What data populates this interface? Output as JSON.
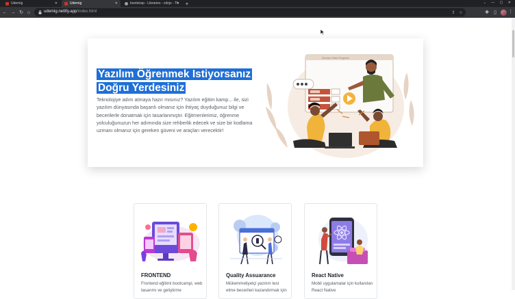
{
  "browser": {
    "tabs": [
      {
        "title": "Udemig"
      },
      {
        "title": "Udemig"
      },
      {
        "title": "bootstrap - Libraries - cdnjs - Th"
      }
    ],
    "new_tab": "+",
    "url_host": "udemig.netlify.app",
    "url_path": "/index.html"
  },
  "hero": {
    "title_line1": "Yazılım Öğrenmek Istiyorsanız",
    "title_line2": "Doğru Yerdesiniz",
    "description": "Teknolojiye adım atmaya hazır mısınız? Yazılım eğitim kamp... ile, sizi yazılım dünyasında başarılı olmanız için ihtiyaç duyduğunuz bilgi ve becerilerle donatmak için tasarlanmıştır. Eğitmenlerimiz, öğrenme yolculuğunuzun her adımında size rehberlik edecek ve size bir kodlama uzmanı olmanız için gereken güveni ve araçları verecektir!",
    "illustration": "online-learning-illustration",
    "illustration_panel_text": "Discover Online Programs"
  },
  "cards": [
    {
      "title": "FRONTEND",
      "text": "Frontend eğitimi bootcampi, web tasarımı ve geliştirme",
      "illustration": "frontend-illustration"
    },
    {
      "title": "Quality Assuarance",
      "text": "Mükemmeliyetçi yazılım test etme becerileri kazandırmak için",
      "illustration": "qa-illustration"
    },
    {
      "title": "React Native",
      "text": "Mobil uygulamalar için kullanılan React Native",
      "illustration": "react-native-illustration"
    }
  ],
  "colors": {
    "highlight": "#1f6fd6",
    "chrome_dark": "#202124",
    "chrome_mid": "#35363a"
  }
}
